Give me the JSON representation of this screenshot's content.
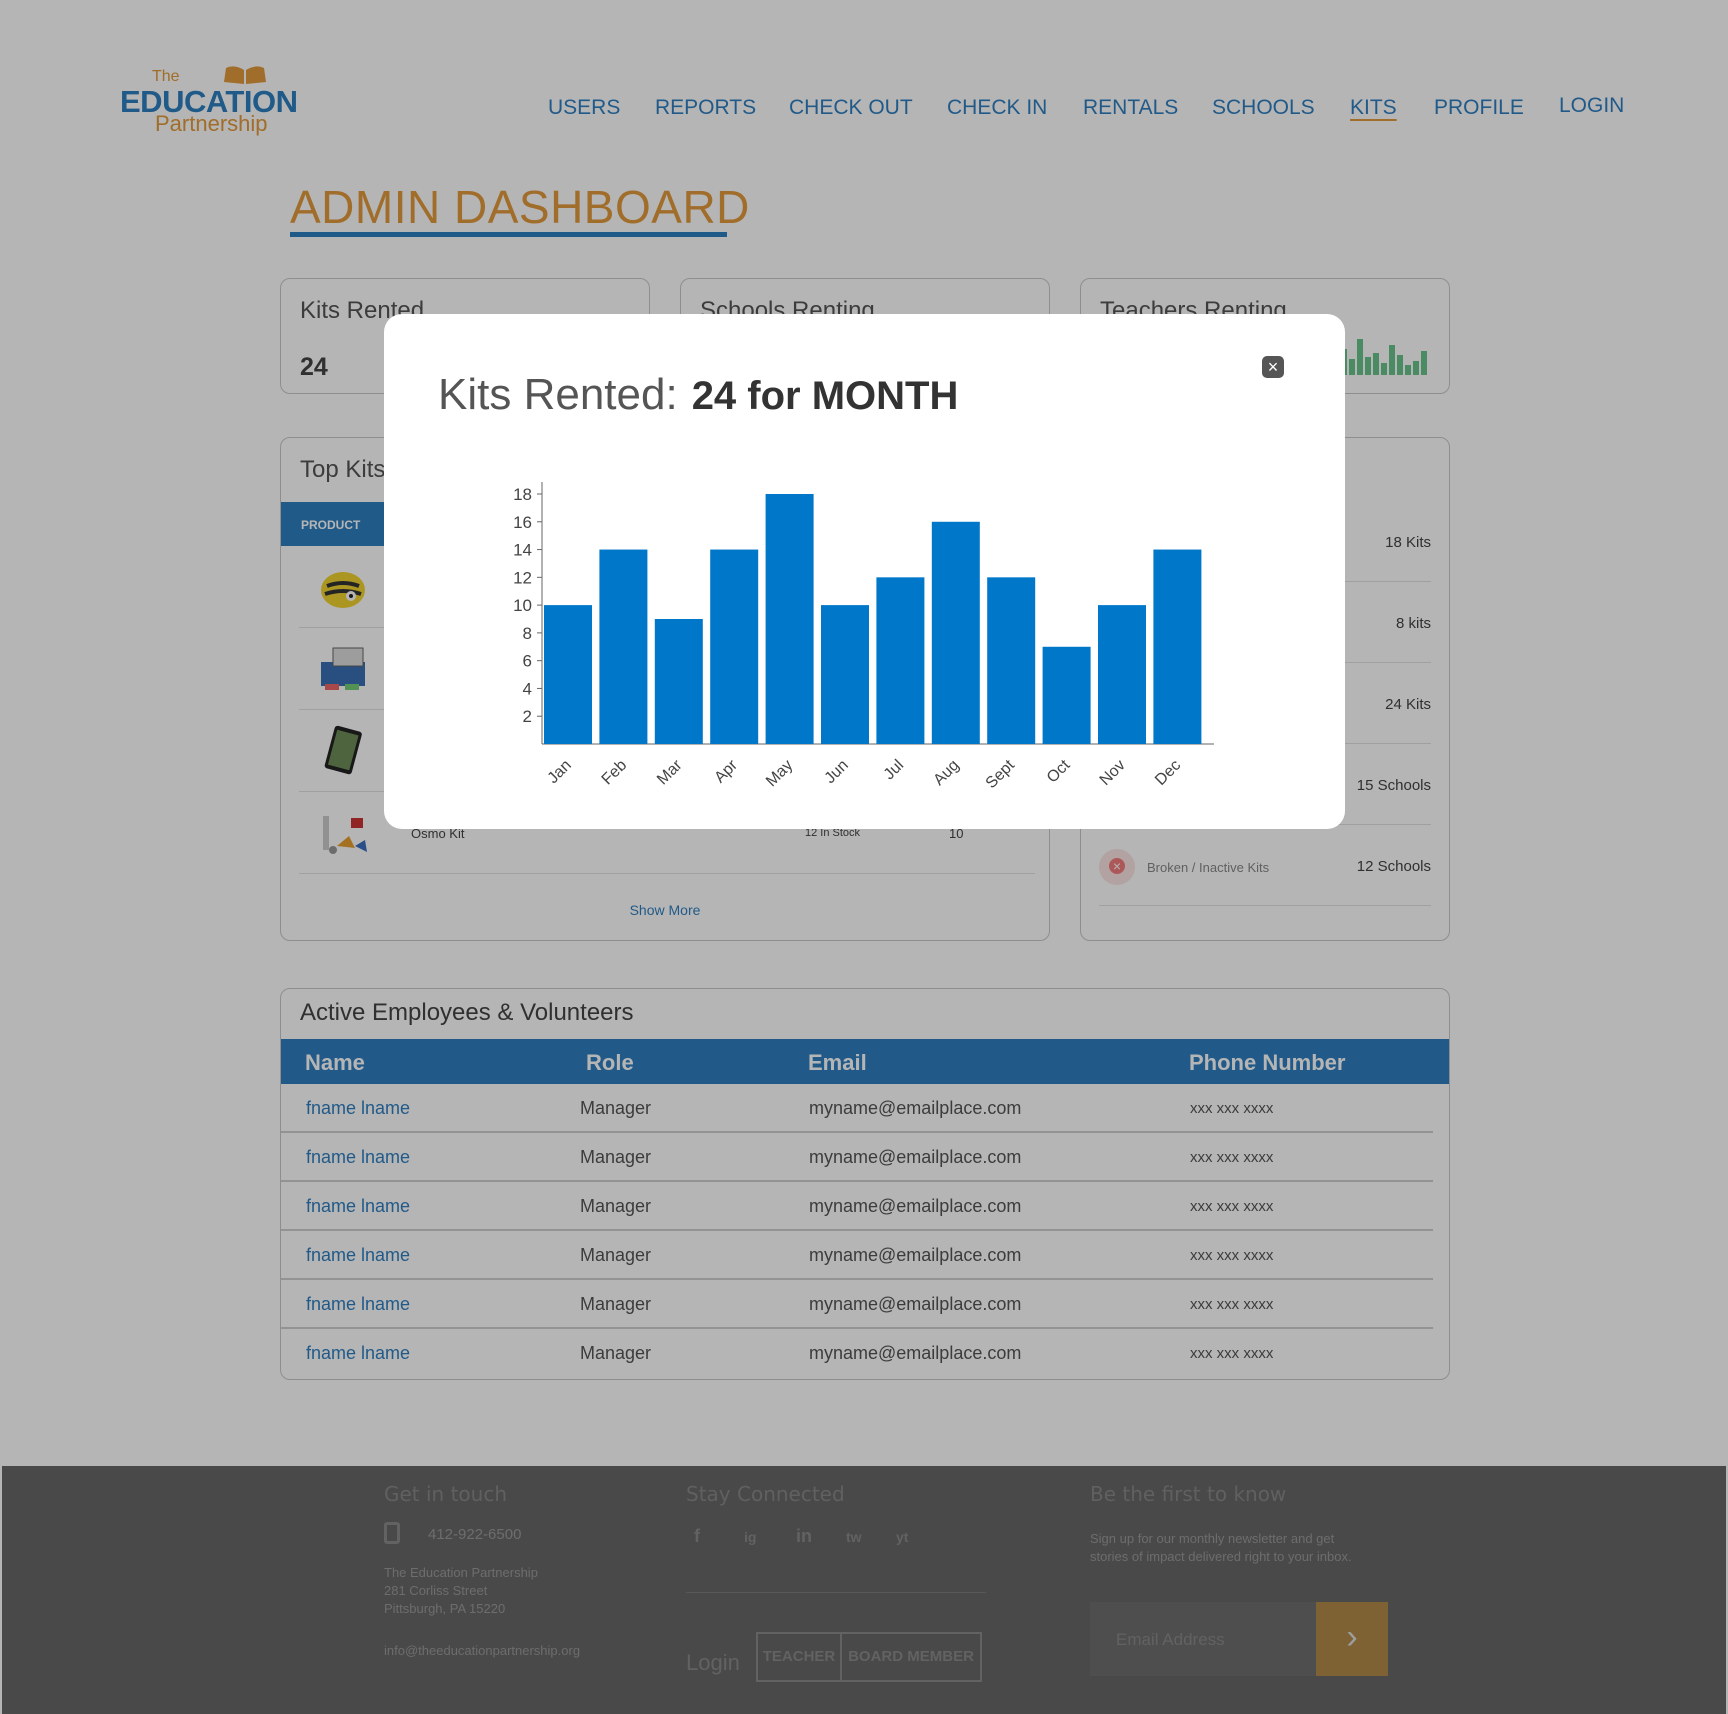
{
  "brand": {
    "the": "The",
    "name": "EDUCATION",
    "sub": "Partnership",
    "tm": "™"
  },
  "nav": [
    {
      "label": "USERS"
    },
    {
      "label": "REPORTS"
    },
    {
      "label": "CHECK OUT"
    },
    {
      "label": "CHECK IN"
    },
    {
      "label": "RENTALS"
    },
    {
      "label": "SCHOOLS"
    },
    {
      "label": "KITS"
    },
    {
      "label": "PROFILE"
    },
    {
      "label": "LOGIN"
    }
  ],
  "page_title": "ADMIN DASHBOARD",
  "stats": {
    "kits_rented": {
      "label": "Kits Rented",
      "value": "24"
    },
    "schools_renting": {
      "label": "Schools Renting"
    },
    "teachers_renting": {
      "label": "Teachers Renting"
    }
  },
  "top_kits": {
    "title": "Top Kits",
    "column_product": "PRODUCT",
    "rows": [
      {
        "name": "",
        "stock": "",
        "qty": ""
      },
      {
        "name": "",
        "stock": "",
        "qty": ""
      },
      {
        "name": "",
        "stock": "",
        "qty": ""
      },
      {
        "name": "Osmo Kit",
        "stock": "12 In Stock",
        "qty": "10"
      }
    ],
    "show_more": "Show More"
  },
  "right_stats": [
    {
      "label": "",
      "value": "18 Kits"
    },
    {
      "label": "",
      "value": "8 kits"
    },
    {
      "label": "",
      "value": "24 Kits"
    },
    {
      "label": "",
      "value": "15 Schools"
    },
    {
      "label": "Broken / Inactive Kits",
      "value": "12 Schools"
    }
  ],
  "employees": {
    "title": "Active Employees & Volunteers",
    "columns": [
      "Name",
      "Role",
      "Email",
      "Phone Number"
    ],
    "rows": [
      {
        "name": "fname lname",
        "role": "Manager",
        "email": "myname@emailplace.com",
        "phone": "xxx xxx xxxx"
      },
      {
        "name": "fname lname",
        "role": "Manager",
        "email": "myname@emailplace.com",
        "phone": "xxx xxx xxxx"
      },
      {
        "name": "fname lname",
        "role": "Manager",
        "email": "myname@emailplace.com",
        "phone": "xxx xxx xxxx"
      },
      {
        "name": "fname lname",
        "role": "Manager",
        "email": "myname@emailplace.com",
        "phone": "xxx xxx xxxx"
      },
      {
        "name": "fname lname",
        "role": "Manager",
        "email": "myname@emailplace.com",
        "phone": "xxx xxx xxxx"
      },
      {
        "name": "fname lname",
        "role": "Manager",
        "email": "myname@emailplace.com",
        "phone": "xxx xxx xxxx"
      }
    ]
  },
  "footer": {
    "get_in_touch": "Get in touch",
    "phone": "412-922-6500",
    "address_lines": [
      "The Education Partnership",
      "281 Corliss Street",
      "Pittsburgh, PA 15220"
    ],
    "email": "info@theeducationpartnership.org",
    "stay_connected": "Stay Connected",
    "social": [
      "f",
      "ig",
      "in",
      "tw",
      "yt"
    ],
    "login_label": "Login",
    "teacher_btn": "TEACHER",
    "board_btn": "BOARD MEMBER",
    "newsletter_head": "Be the first to know",
    "newsletter_text": [
      "Sign up for our monthly newsletter and get",
      "stories of impact delivered right to your inbox."
    ],
    "email_placeholder": "Email Address",
    "submit_glyph": "›"
  },
  "modal": {
    "title": "Kits Rented:",
    "title_strong": "24 for MONTH",
    "close_glyph": "×"
  },
  "colors": {
    "accent_blue": "#2d7fc0",
    "accent_orange": "#e39a3c",
    "bar_blue": "#0077c8",
    "spark_green": "#69c48e"
  },
  "chart_data": {
    "type": "bar",
    "categories": [
      "Jan",
      "Feb",
      "Mar",
      "Apr",
      "May",
      "Jun",
      "Jul",
      "Aug",
      "Sept",
      "Oct",
      "Nov",
      "Dec"
    ],
    "values": [
      10,
      14,
      9,
      14,
      18,
      10,
      12,
      16,
      12,
      7,
      10,
      14
    ],
    "yticks": [
      2,
      4,
      6,
      8,
      10,
      12,
      14,
      16,
      18
    ],
    "ylim": [
      0,
      18
    ],
    "title": "",
    "xlabel": "",
    "ylabel": ""
  }
}
